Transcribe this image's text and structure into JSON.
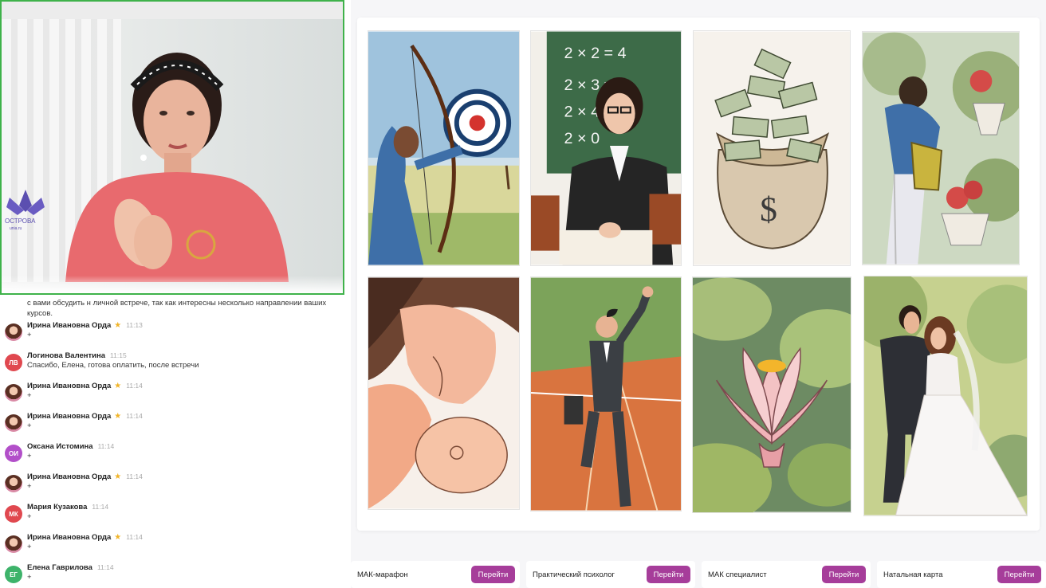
{
  "chat": {
    "prev_text": "с вами обсудить н личной встрече, так как интересны несколько направлении ваших курсов.",
    "messages": [
      {
        "initials": "",
        "name": "Ирина Ивановна Орда",
        "star": "★",
        "time": "11:13",
        "text": "+",
        "color": "#d98aa5"
      },
      {
        "initials": "ЛВ",
        "name": "Логинова Валентина",
        "star": "",
        "time": "11:15",
        "text": "Спасибо, Елена, готова оплатить, после встречи",
        "color": "#e0484f"
      },
      {
        "initials": "",
        "name": "Ирина Ивановна Орда",
        "star": "★",
        "time": "11:14",
        "text": "+",
        "color": "#d98aa5"
      },
      {
        "initials": "",
        "name": "Ирина Ивановна Орда",
        "star": "★",
        "time": "11:14",
        "text": "+",
        "color": "#d98aa5"
      },
      {
        "initials": "ОИ",
        "name": "Оксана Истомина",
        "star": "",
        "time": "11:14",
        "text": "+",
        "color": "#b24fc9"
      },
      {
        "initials": "",
        "name": "Ирина Ивановна Орда",
        "star": "★",
        "time": "11:14",
        "text": "+",
        "color": "#d98aa5"
      },
      {
        "initials": "МК",
        "name": "Мария Кузакова",
        "star": "",
        "time": "11:14",
        "text": "+",
        "color": "#e0484f"
      },
      {
        "initials": "",
        "name": "Ирина Ивановна Орда",
        "star": "★",
        "time": "11:14",
        "text": "+",
        "color": "#d98aa5"
      },
      {
        "initials": "ЕГ",
        "name": "Елена Гаврилова",
        "star": "",
        "time": "11:14",
        "text": "+",
        "color": "#3db36a"
      }
    ]
  },
  "video": {
    "logo_text": "ОСТРОВА",
    "logo_url": "unia.ru"
  },
  "board": {
    "chalk": [
      "2 × 2 = 4",
      "2 × 3 = 6",
      "2 × 4",
      "2 ×   0"
    ]
  },
  "cards": [
    {
      "name": "archer-card",
      "icon": "archer"
    },
    {
      "name": "teacher-card",
      "icon": "teacher"
    },
    {
      "name": "money-bag-card",
      "icon": "money-bag"
    },
    {
      "name": "gardener-card",
      "icon": "gardener"
    },
    {
      "name": "mother-baby-card",
      "icon": "mother-baby"
    },
    {
      "name": "runner-card",
      "icon": "runner"
    },
    {
      "name": "lotus-card",
      "icon": "lotus"
    },
    {
      "name": "wedding-card",
      "icon": "wedding"
    }
  ],
  "courses": [
    {
      "name": "МАК-марафон",
      "button": "Перейти"
    },
    {
      "name": "Практический психолог",
      "button": "Перейти"
    },
    {
      "name": "МАК специалист",
      "button": "Перейти"
    },
    {
      "name": "Натальная карта",
      "button": "Перейти"
    }
  ],
  "colors": {
    "accent": "#a63d9a",
    "video_border": "#3fb24a"
  }
}
